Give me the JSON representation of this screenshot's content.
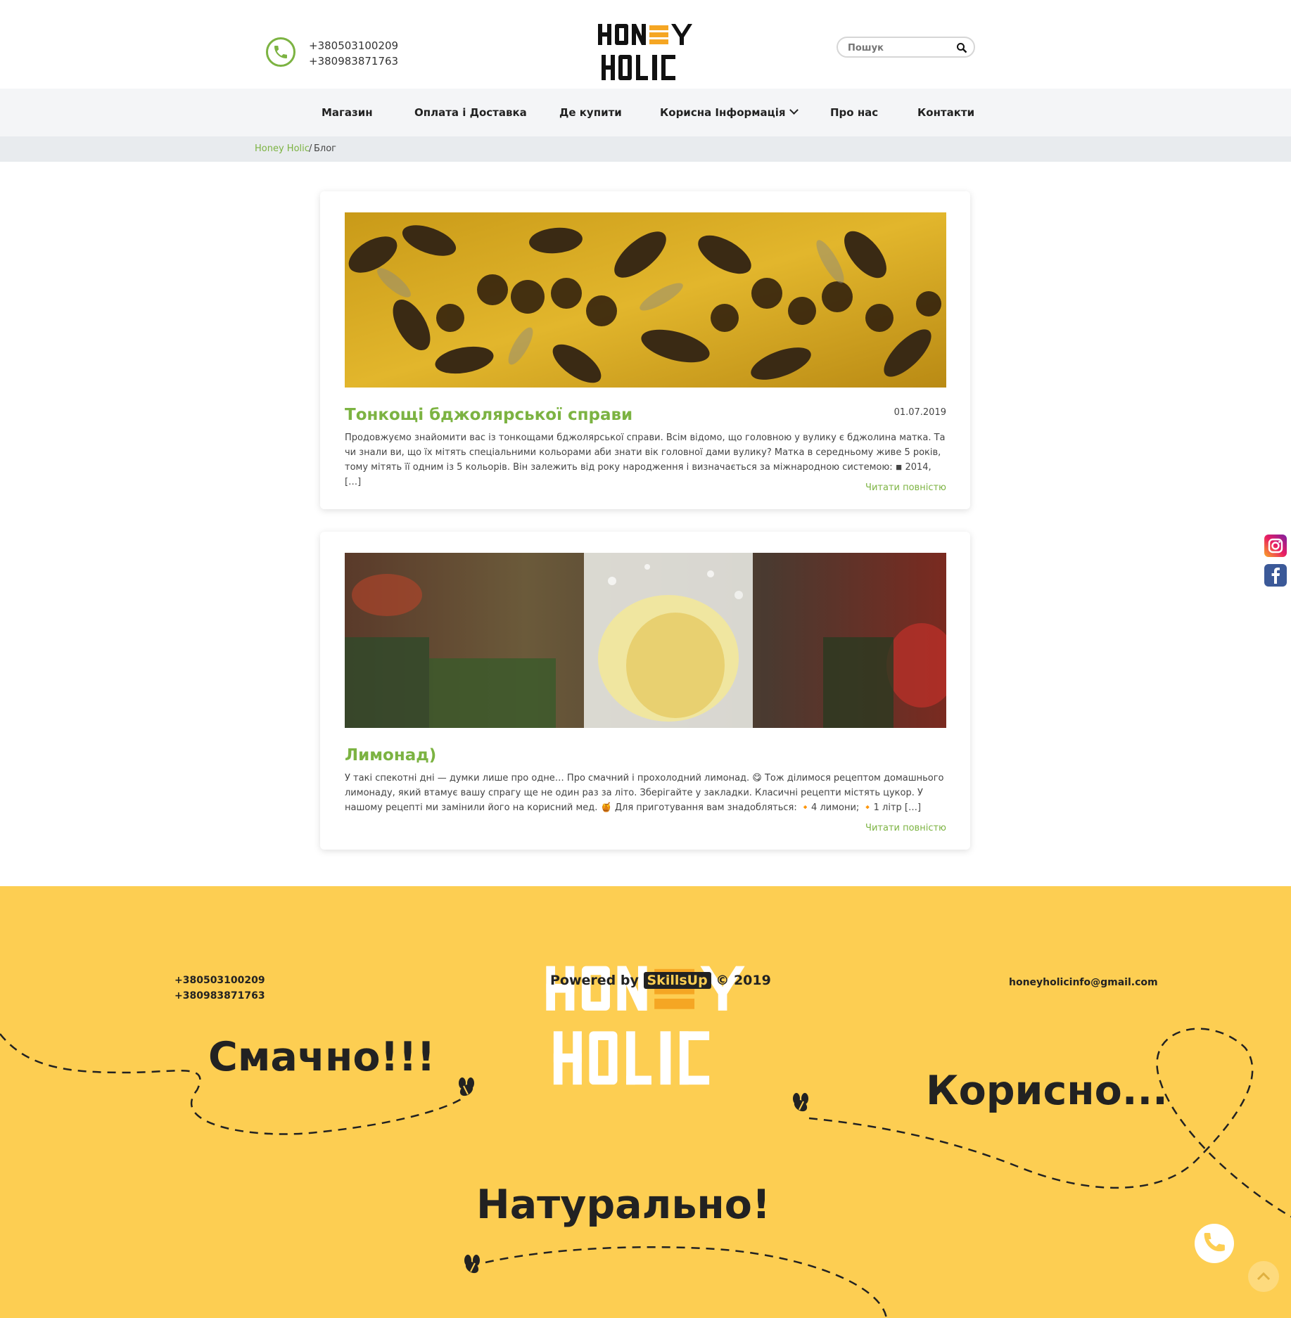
{
  "header": {
    "phones": [
      "+380503100209",
      "+380983871763"
    ],
    "logo_text": [
      "HONEY",
      "HOLIC"
    ],
    "search_placeholder": "Пошук"
  },
  "nav": {
    "items": [
      {
        "label": "Магазин"
      },
      {
        "label": "Оплата і Доставка"
      },
      {
        "label": "Де купити"
      },
      {
        "label": "Корисна Інформація"
      },
      {
        "label": "Про нас"
      },
      {
        "label": "Контакти"
      }
    ]
  },
  "breadcrumb": {
    "home": "Honey Holic",
    "separator": "/",
    "current": "Блог"
  },
  "posts": [
    {
      "title": "Тонкощі бджолярської справи",
      "date": "01.07.2019",
      "excerpt": "Продовжуємо знайомити вас із тонкощами бджолярської справи. Всім відомо, що головною у вулику є бджолина матка. Та чи знали ви, що їх мітять спеціальними кольорами аби знати вік головної дами вулику? Матка в середньому живе 5 років, тому мітять її одним із 5 кольорів. Він залежить від року народження і визначається за міжнародною системою:  ◾ 2014, […]",
      "read_more": "Читати повністю",
      "image_icon": "bees-honeycomb-photo"
    },
    {
      "title": "Лимонад)",
      "date": "",
      "excerpt": "У такі спекотні дні — думки лише про одне… Про смачний і прохолодний лимонад. 😋 Тож ділимося рецептом домашнього лимонаду, який втамує вашу спрагу ще не один раз за літо. Зберігайте у закладки. Класичні рецепти містять цукор. У нашому рецепті ми замінили його на корисний мед. 🍯 Для приготування вам знадобляться: 🔸4 лимони; 🔸1 літр […]",
      "read_more": "Читати повністю",
      "image_icon": "lemonade-glass-photo"
    }
  ],
  "social": [
    "instagram-icon",
    "facebook-icon"
  ],
  "footer": {
    "logo_text": [
      "HONEY",
      "HOLIC"
    ],
    "slogans": [
      "Смачно!!!",
      "Корисно...",
      "Натурально!"
    ],
    "phones": [
      "+380503100209",
      "+380983871763"
    ],
    "powered_prefix": "Powered by",
    "powered_brand": "SkillsUp",
    "powered_suffix": "© 2019",
    "email": "honeyholicinfo@gmail.com"
  },
  "colors": {
    "accent_green": "#7cb342",
    "footer_yellow": "#fdce52",
    "honey_orange": "#f5a623",
    "dark": "#222222"
  }
}
